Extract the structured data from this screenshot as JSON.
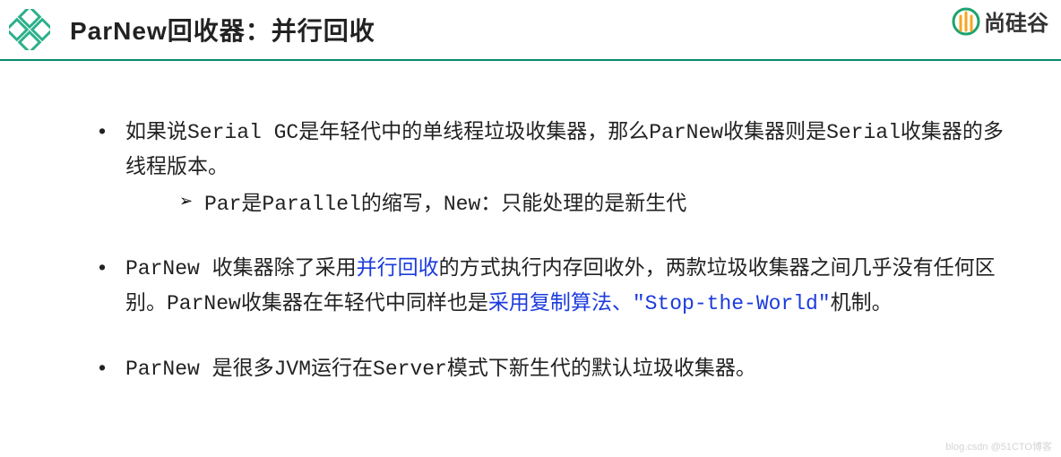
{
  "header": {
    "title": "ParNew回收器：并行回收",
    "brand": "尚硅谷"
  },
  "bullets": [
    {
      "segments": [
        {
          "text": "如果说",
          "cls": ""
        },
        {
          "text": "Serial GC",
          "cls": "mono"
        },
        {
          "text": "是年轻代中的单线程垃圾收集器，那么",
          "cls": ""
        },
        {
          "text": "ParNew",
          "cls": "mono"
        },
        {
          "text": "收集器则是",
          "cls": ""
        },
        {
          "text": "Serial",
          "cls": "mono"
        },
        {
          "text": "收集器的多线程版本。",
          "cls": ""
        }
      ],
      "sub": {
        "segments": [
          {
            "text": "Par",
            "cls": "mono"
          },
          {
            "text": "是",
            "cls": ""
          },
          {
            "text": "Parallel",
            "cls": "mono"
          },
          {
            "text": "的缩写，",
            "cls": ""
          },
          {
            "text": "New",
            "cls": "mono"
          },
          {
            "text": "：只能处理的是新生代",
            "cls": ""
          }
        ]
      }
    },
    {
      "segments": [
        {
          "text": "ParNew ",
          "cls": "mono"
        },
        {
          "text": "收集器除了采用",
          "cls": ""
        },
        {
          "text": "并行回收",
          "cls": "hl"
        },
        {
          "text": "的方式执行内存回收外，两款垃圾收集器之间几乎没有任何区别。",
          "cls": ""
        },
        {
          "text": "ParNew",
          "cls": "mono"
        },
        {
          "text": "收集器在年轻代中同样也是",
          "cls": ""
        },
        {
          "text": "采用复制算法",
          "cls": "hl"
        },
        {
          "text": "、",
          "cls": "hl"
        },
        {
          "text": "\"Stop-the-World\"",
          "cls": "hl mono"
        },
        {
          "text": "机制。",
          "cls": ""
        }
      ]
    },
    {
      "segments": [
        {
          "text": "ParNew ",
          "cls": "mono"
        },
        {
          "text": "是很多",
          "cls": ""
        },
        {
          "text": "JVM",
          "cls": "mono"
        },
        {
          "text": "运行在",
          "cls": ""
        },
        {
          "text": "Server",
          "cls": "mono"
        },
        {
          "text": "模式下新生代的默认垃圾收集器。",
          "cls": ""
        }
      ]
    }
  ],
  "watermark": "blog.csdn @51CTO博客"
}
